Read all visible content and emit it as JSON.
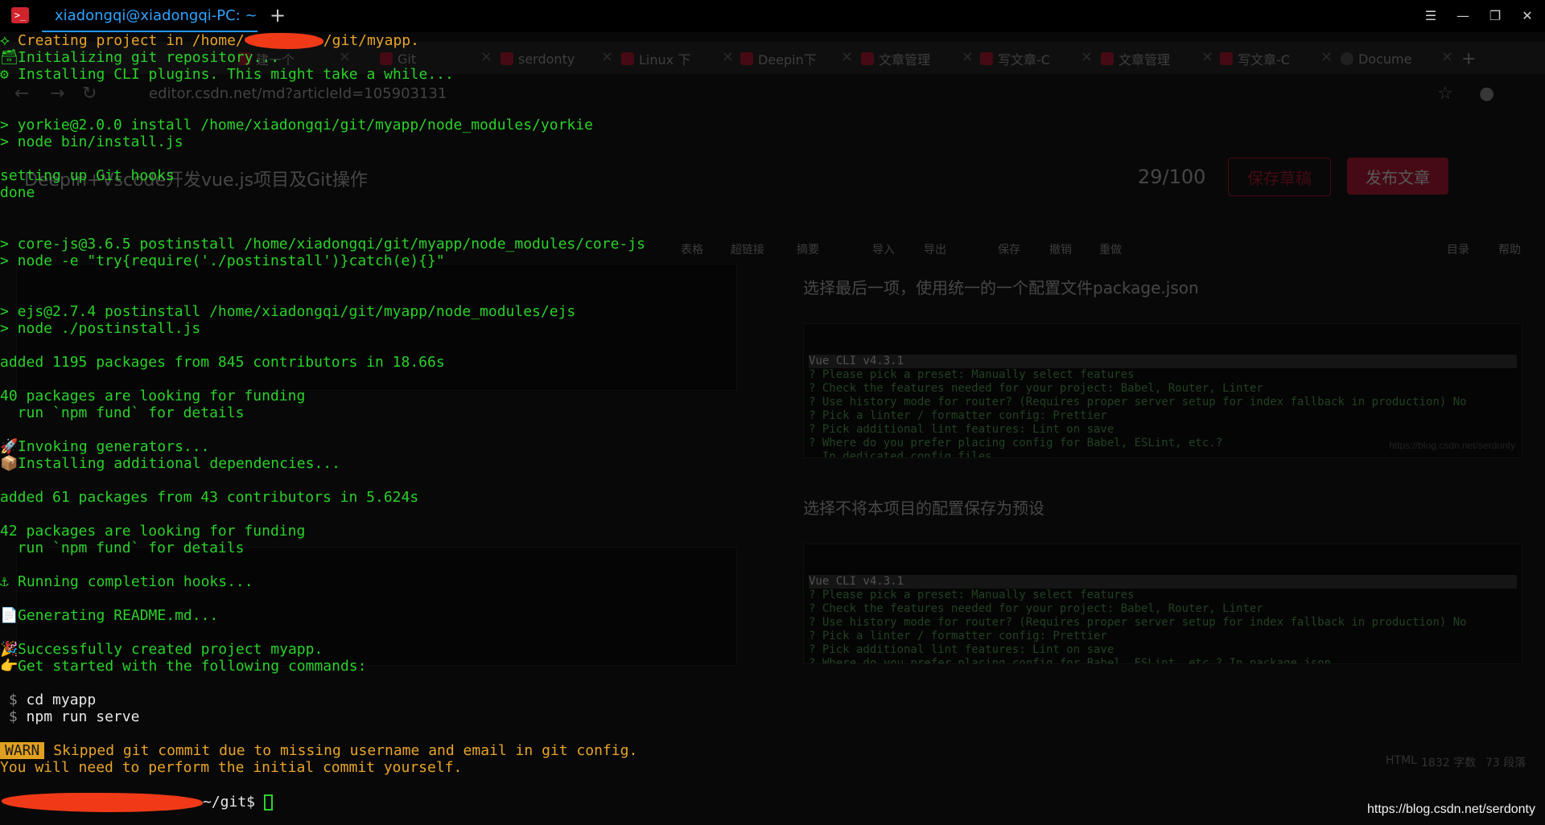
{
  "terminal": {
    "tab_title": "xiadongqi@xiadongqi-PC: ~",
    "new_tab_symbol": "+",
    "window_controls": {
      "menu": "☰",
      "minimize": "—",
      "restore": "❐",
      "close": "✕"
    },
    "lines": {
      "l1": {
        "icon": "⟡",
        "pre": "Creating project in /home/",
        "post": "/git/myapp."
      },
      "l2": {
        "icon": "🗃",
        "text": "Initializing git repository..."
      },
      "l3": {
        "icon": "⚙",
        "text": "Installing CLI plugins. This might take a while..."
      },
      "l4": "> yorkie@2.0.0 install /home/xiadongqi/git/myapp/node_modules/yorkie",
      "l5": "> node bin/install.js",
      "l6": "setting up Git hooks",
      "l7": "done",
      "l8": "> core-js@3.6.5 postinstall /home/xiadongqi/git/myapp/node_modules/core-js",
      "l9": "> node -e \"try{require('./postinstall')}catch(e){}\"",
      "l10": "> ejs@2.7.4 postinstall /home/xiadongqi/git/myapp/node_modules/ejs",
      "l11": "> node ./postinstall.js",
      "l12": "added 1195 packages from 845 contributors in 18.66s",
      "l13": "40 packages are looking for funding",
      "l14": "  run `npm fund` for details",
      "l15": {
        "icon": "🚀",
        "text": "Invoking generators..."
      },
      "l16": {
        "icon": "📦",
        "text": "Installing additional dependencies..."
      },
      "l17": "added 61 packages from 43 contributors in 5.624s",
      "l18": "42 packages are looking for funding",
      "l19": "  run `npm fund` for details",
      "l20": {
        "icon": "⚓",
        "text": "Running completion hooks..."
      },
      "l21": {
        "icon": "📄",
        "text": "Generating README.md..."
      },
      "l22": {
        "icon": "🎉",
        "text": "Successfully created project myapp."
      },
      "l23": {
        "icon": "👉",
        "text": "Get started with the following commands:"
      },
      "l24": {
        "prompt": "$",
        "text": "cd myapp"
      },
      "l25": {
        "prompt": "$",
        "text": "npm run serve"
      },
      "l26": {
        "badge": "WARN",
        "text": "Skipped git commit due to missing username and email in git config."
      },
      "l27": "You will need to perform the initial commit yourself.",
      "l28": {
        "prompt_tail": "~/git$"
      }
    }
  },
  "background_browser": {
    "tabs": [
      {
        "label": "建一个"
      },
      {
        "label": "Git"
      },
      {
        "label": "serdonty"
      },
      {
        "label": "Linux 下"
      },
      {
        "label": "Deepin下"
      },
      {
        "label": "文章管理"
      },
      {
        "label": "写文章-C"
      },
      {
        "label": "文章管理"
      },
      {
        "label": "写文章-C"
      },
      {
        "label": "Docume"
      }
    ],
    "address": "editor.csdn.net/md?articleId=105903131",
    "article_title": "Deepin+Vscode开发vue.js项目及Git操作",
    "word_count": "29/100",
    "save_draft": "保存草稿",
    "publish": "发布文章",
    "toolbar": [
      "表格",
      "超链接",
      "摘要",
      "导入",
      "导出",
      "保存",
      "撤销",
      "重做",
      "目录",
      "帮助"
    ],
    "preview_text_1": "选择最后一项，使用统一的一个配置文件package.json",
    "preview_text_2": "选择不将本项目的配置保存为预设",
    "code1": {
      "head": "Vue CLI v4.3.1",
      "body": "? Please pick a preset: Manually select features\n? Check the features needed for your project: Babel, Router, Linter\n? Use history mode for router? (Requires proper server setup for index fallback in production) No\n? Pick a linter / formatter config: Prettier\n? Pick additional lint features: Lint on save\n? Where do you prefer placing config for Babel, ESLint, etc.?\n  In dedicated config files\n❯ In package.json"
    },
    "code2": {
      "head": "Vue CLI v4.3.1",
      "body": "? Please pick a preset: Manually select features\n? Check the features needed for your project: Babel, Router, Linter\n? Use history mode for router? (Requires proper server setup for index fallback in production) No\n? Pick a linter / formatter config: Prettier\n? Pick additional lint features: Lint on save\n? Where do you prefer placing config for Babel, ESLint, etc.? In package.json\n? Save this as a preset for future projects? (y/N) N"
    },
    "code_watermark": "https://blog.csdn.net/serdonty",
    "status": {
      "mode": "HTML",
      "chars": "1832 字数",
      "lines": "73 段落"
    }
  },
  "watermark": "https://blog.csdn.net/serdonty",
  "colors": {
    "terminal_green": "#2bd12b",
    "accent_blue": "#2196f3",
    "warn": "#e0a020",
    "redact": "#f03a17"
  }
}
